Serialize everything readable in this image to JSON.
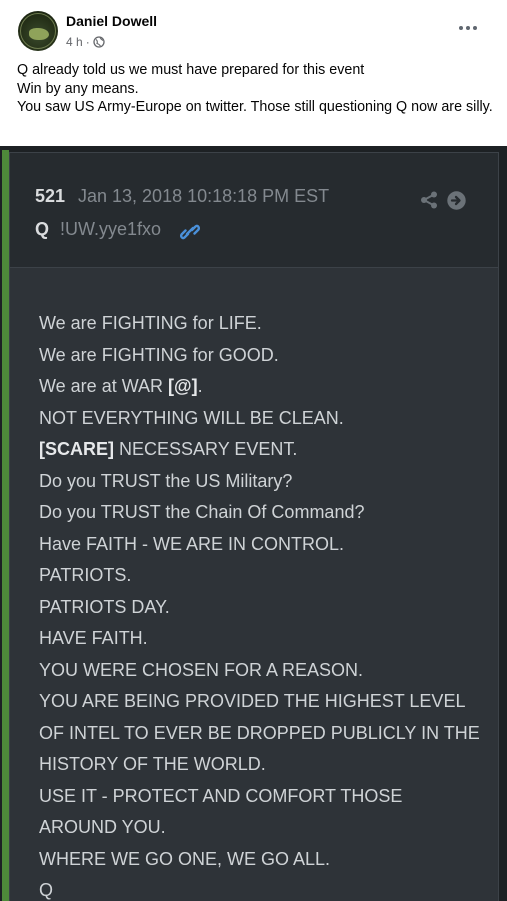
{
  "post": {
    "author": "Daniel Dowell",
    "time": "4 h",
    "separator": "·",
    "audience_icon": "globe-icon",
    "lines": [
      "Q already told us we must have prepared for this event",
      "Win by any means.",
      "You saw US Army-Europe on twitter. Those still questioning Q now are silly."
    ]
  },
  "image": {
    "post_number": "521",
    "date": "Jan 13, 2018 10:18:18 PM EST",
    "signature": "Q",
    "tripcode": "!UW.yye1fxo",
    "icons": [
      "link-icon",
      "share-icon",
      "arrow-right-circle-icon"
    ],
    "colors": {
      "background": "#1d2124",
      "panel": "#2e3338",
      "accent_bar": "#4e8a3a",
      "link": "#4a90d9"
    },
    "body": [
      {
        "pre": "We are FIGHTING for LIFE.",
        "bold": "",
        "post": ""
      },
      {
        "pre": "We are FIGHTING for GOOD.",
        "bold": "",
        "post": ""
      },
      {
        "pre": "We are at WAR ",
        "bold": "[@]",
        "post": "."
      },
      {
        "pre": "NOT EVERYTHING WILL BE CLEAN.",
        "bold": "",
        "post": ""
      },
      {
        "pre": "",
        "bold": "[SCARE]",
        "post": " NECESSARY EVENT."
      },
      {
        "pre": "Do you TRUST the US Military?",
        "bold": "",
        "post": ""
      },
      {
        "pre": "Do you TRUST the Chain Of Command?",
        "bold": "",
        "post": ""
      },
      {
        "pre": "Have FAITH - WE ARE IN CONTROL.",
        "bold": "",
        "post": ""
      },
      {
        "pre": "PATRIOTS.",
        "bold": "",
        "post": ""
      },
      {
        "pre": "PATRIOTS DAY.",
        "bold": "",
        "post": ""
      },
      {
        "pre": "HAVE FAITH.",
        "bold": "",
        "post": ""
      },
      {
        "pre": "YOU WERE CHOSEN FOR A REASON.",
        "bold": "",
        "post": ""
      },
      {
        "pre": "YOU ARE BEING PROVIDED THE HIGHEST LEVEL",
        "bold": "",
        "post": ""
      },
      {
        "pre": "OF INTEL TO EVER BE DROPPED PUBLICLY IN THE",
        "bold": "",
        "post": ""
      },
      {
        "pre": "HISTORY OF THE WORLD.",
        "bold": "",
        "post": ""
      },
      {
        "pre": "USE IT - PROTECT AND COMFORT THOSE",
        "bold": "",
        "post": ""
      },
      {
        "pre": "AROUND YOU.",
        "bold": "",
        "post": ""
      },
      {
        "pre": "WHERE WE GO ONE, WE GO ALL.",
        "bold": "",
        "post": ""
      },
      {
        "pre": "Q",
        "bold": "",
        "post": ""
      }
    ]
  }
}
